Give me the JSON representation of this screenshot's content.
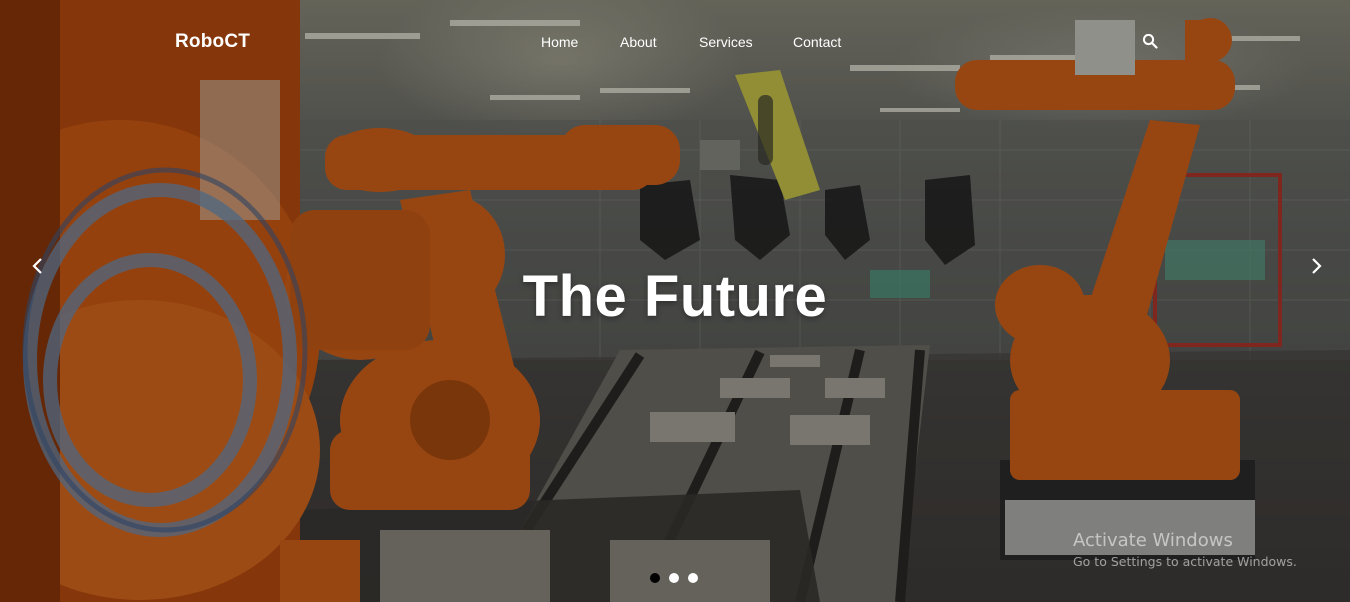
{
  "navbar": {
    "brand": "RoboCT",
    "links": [
      {
        "label": "Home"
      },
      {
        "label": "About"
      },
      {
        "label": "Services"
      },
      {
        "label": "Contact"
      }
    ],
    "search_icon": "search-icon"
  },
  "carousel": {
    "headline": "The Future",
    "prev_icon": "chevron-left-icon",
    "next_icon": "chevron-right-icon",
    "indicators": [
      {
        "active": true
      },
      {
        "active": false
      },
      {
        "active": false
      }
    ],
    "background": "industrial robot arms assembly line photo"
  },
  "watermark": {
    "title": "Activate Windows",
    "subtitle": "Go to Settings to activate Windows."
  },
  "colors": {
    "text": "#ffffff",
    "robot_orange": "#d2621a",
    "indicator_active": "#000000",
    "indicator_inactive": "#ffffff"
  }
}
